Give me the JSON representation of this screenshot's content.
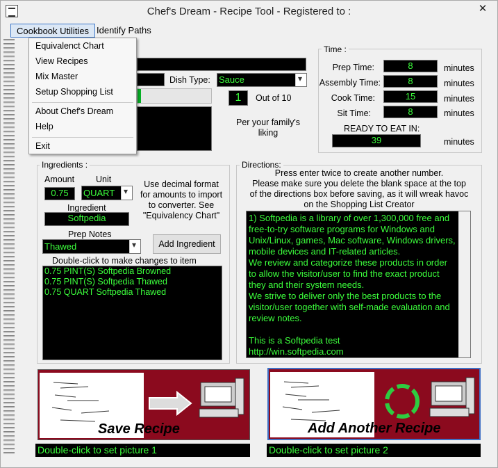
{
  "window": {
    "title": "Chef's Dream - Recipe Tool - Registered to :",
    "close": "✕"
  },
  "menubar": {
    "items": [
      "Cookbook Utilities",
      "Identify Paths"
    ]
  },
  "dropdown": {
    "items": [
      "Equivalenct Chart",
      "View Recipes",
      "Mix Master",
      "Setup Shopping List",
      "About Chef's Dream",
      "Help",
      "Exit"
    ]
  },
  "recipe": {
    "dish_type_label": "Dish Type:",
    "dish_type_value": "Sauce",
    "rating_value": "1",
    "rating_suffix": "Out of 10",
    "rating_caption_line1": "Per your family's",
    "rating_caption_line2": "liking"
  },
  "time": {
    "title": "Time :",
    "rows": [
      {
        "label": "Prep Time:",
        "value": "8",
        "unit": "minutes"
      },
      {
        "label": "Assembly Time:",
        "value": "8",
        "unit": "minutes"
      },
      {
        "label": "Cook Time:",
        "value": "15",
        "unit": "minutes"
      },
      {
        "label": "Sit Time:",
        "value": "8",
        "unit": "minutes"
      }
    ],
    "ready_label": "READY TO EAT IN:",
    "ready_value": "39",
    "ready_unit": "minutes"
  },
  "ingredients": {
    "title": "Ingredients :",
    "amount_label": "Amount",
    "unit_label": "Unit",
    "amount_value": "0.75",
    "unit_value": "QUART",
    "hint_lines": [
      "Use decimal format",
      "for amounts to import",
      "to converter. See",
      "\"Equivalency Chart\""
    ],
    "ingredient_label": "Ingredient",
    "ingredient_value": "Softpedia",
    "prep_notes_label": "Prep Notes",
    "prep_notes_value": "Thawed",
    "add_button": "Add Ingredient",
    "list_hint": "Double-click to make changes to item",
    "list": [
      "0.75 PINT(S) Softpedia Browned",
      "0.75 PINT(S) Softpedia Thawed",
      "0.75 QUART Softpedia Thawed"
    ]
  },
  "directions": {
    "title": "Directions:",
    "note_lines": [
      "Press enter twice to create another number.",
      "Please make sure you delete the blank space at the top",
      "of the directions box before saving, as it will wreak havoc",
      "on the Shopping List Creator"
    ],
    "text_lines": [
      "1) Softpedia is a library of over 1,300,000 free and",
      "free-to-try software programs for Windows and",
      "Unix/Linux, games, Mac software, Windows drivers,",
      "mobile devices and IT-related articles.",
      "We review and categorize these products in order",
      "to allow the visitor/user to find the exact product",
      "they and their system needs.",
      "We strive to deliver only the best products to the",
      "visitor/user together with self-made evaluation and",
      "review notes.",
      "",
      "This is a Softpedia test",
      "http://win.softpedia.com"
    ]
  },
  "pictures": {
    "save_caption": "Save Recipe",
    "save_hint": "Double-click to set picture 1",
    "add_caption": "Add Another Recipe",
    "add_hint": "Double-click to set picture 2"
  },
  "colors": {
    "field_bg": "#000000",
    "field_text": "#3cff3c",
    "panel_red": "#8b0a1e"
  }
}
